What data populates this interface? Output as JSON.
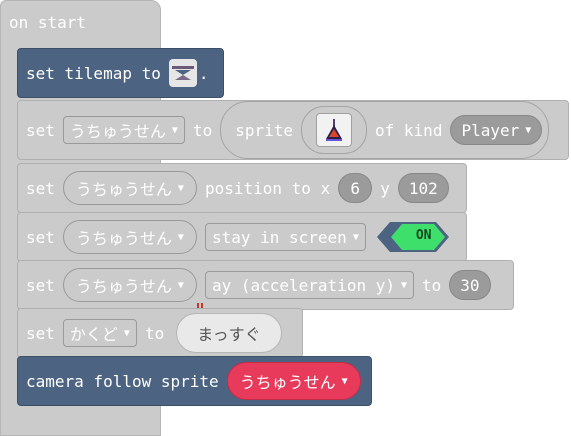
{
  "on_start": {
    "label": "on start"
  },
  "set_tilemap": {
    "label": "set tilemap to",
    "suffix": "."
  },
  "set_sprite": {
    "set": "set",
    "var": "うちゅうせん",
    "to": "to",
    "sprite": "sprite",
    "of_kind": "of kind",
    "kind": "Player"
  },
  "set_position": {
    "set": "set",
    "var": "うちゅうせん",
    "prop": "position to x",
    "x": "6",
    "y_label": "y",
    "y": "102"
  },
  "set_stay": {
    "set": "set",
    "var": "うちゅうせん",
    "prop": "stay in screen",
    "state": "ON"
  },
  "set_ay": {
    "set": "set",
    "var": "うちゅうせん",
    "prop": "ay (acceleration y)",
    "to": "to",
    "value": "30"
  },
  "set_angle": {
    "set": "set",
    "var": "かくど",
    "to": "to",
    "value": "まっすぐ"
  },
  "camera": {
    "label": "camera follow sprite",
    "var": "うちゅうせん"
  },
  "colors": {
    "control": "#cbcbcb",
    "blue": "#4c6381",
    "toggle_on": "#3ee06b",
    "sprite_red": "#e83a5a"
  }
}
